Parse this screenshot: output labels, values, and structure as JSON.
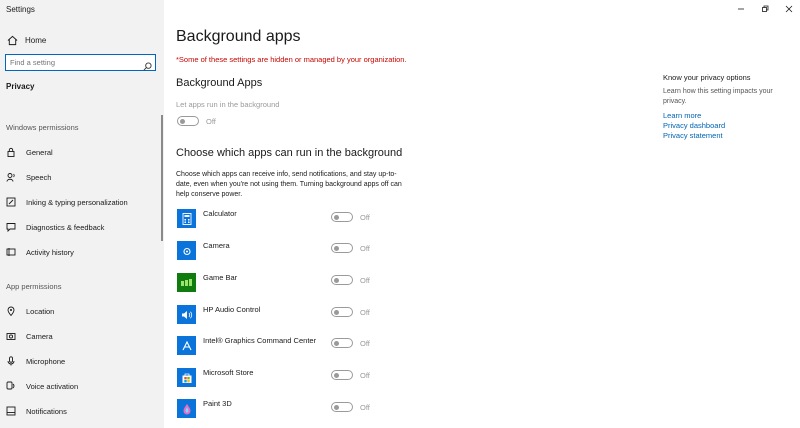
{
  "window": {
    "title": "Settings",
    "controls": [
      "minimize-icon",
      "maximize-icon",
      "close-icon"
    ]
  },
  "sidebar": {
    "home_label": "Home",
    "search": {
      "placeholder": "Find a setting",
      "icon": "search-icon"
    },
    "category": "Privacy",
    "windows_permissions_label": "Windows permissions",
    "windows_permissions": [
      {
        "label": "General",
        "icon": "lock-icon"
      },
      {
        "label": "Speech",
        "icon": "speech-icon"
      },
      {
        "label": "Inking & typing personalization",
        "icon": "pen-icon"
      },
      {
        "label": "Diagnostics & feedback",
        "icon": "feedback-icon"
      },
      {
        "label": "Activity history",
        "icon": "history-icon"
      }
    ],
    "app_permissions_label": "App permissions",
    "app_permissions": [
      {
        "label": "Location",
        "icon": "location-icon"
      },
      {
        "label": "Camera",
        "icon": "camera-icon"
      },
      {
        "label": "Microphone",
        "icon": "microphone-icon"
      },
      {
        "label": "Voice activation",
        "icon": "voice-icon"
      },
      {
        "label": "Notifications",
        "icon": "notification-icon"
      }
    ]
  },
  "main": {
    "title": "Background apps",
    "warning": "*Some of these settings are hidden or managed by your organization.",
    "section1_title": "Background Apps",
    "run_label": "Let apps run in the background",
    "run_state": "Off",
    "section2_title": "Choose which apps can run in the background",
    "description": "Choose which apps can receive info, send notifications, and stay up-to-date, even when you're not using them. Turning background apps off can help conserve power.",
    "apps": [
      {
        "name": "Calculator",
        "state": "Off",
        "icon": "calculator-icon"
      },
      {
        "name": "Camera",
        "state": "Off",
        "icon": "camera-app-icon"
      },
      {
        "name": "Game Bar",
        "state": "Off",
        "icon": "game-bar-icon"
      },
      {
        "name": "HP Audio Control",
        "state": "Off",
        "icon": "audio-icon"
      },
      {
        "name": "Intel® Graphics Command Center",
        "state": "Off",
        "icon": "intel-graphics-icon"
      },
      {
        "name": "Microsoft Store",
        "state": "Off",
        "icon": "store-icon"
      },
      {
        "name": "Paint 3D",
        "state": "Off",
        "icon": "paint3d-icon"
      }
    ]
  },
  "right_panel": {
    "heading": "Know your privacy options",
    "description": "Learn how this setting impacts your privacy.",
    "links": [
      "Learn more",
      "Privacy dashboard",
      "Privacy statement"
    ]
  },
  "colors": {
    "accent": "#0067c0",
    "warning": "#c50500",
    "link": "#0063b1",
    "app_tile": "#0a74da",
    "game_bar_tile": "#107c10"
  }
}
